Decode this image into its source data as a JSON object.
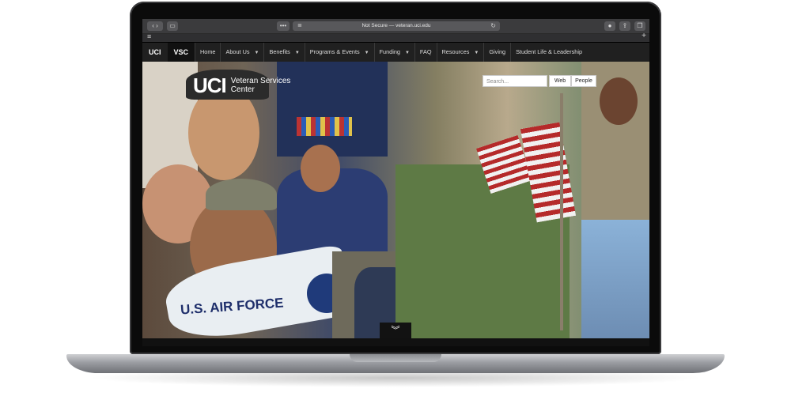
{
  "browser": {
    "url_text": "Not Secure — veteran.uci.edu",
    "dots": "•••",
    "menu": "≡",
    "plus": "+",
    "icons": [
      "back-icon",
      "forward-icon",
      "sidebar-icon",
      "reader-icon",
      "reload-icon",
      "info-icon",
      "share-icon",
      "tabs-icon"
    ]
  },
  "nav": {
    "brand": "UCI",
    "vsc": "VSC",
    "items": [
      {
        "label": "Home",
        "dropdown": false
      },
      {
        "label": "About Us",
        "dropdown": true
      },
      {
        "label": "Benefits",
        "dropdown": true
      },
      {
        "label": "Programs & Events",
        "dropdown": true
      },
      {
        "label": "Funding",
        "dropdown": true
      },
      {
        "label": "FAQ",
        "dropdown": false
      },
      {
        "label": "Resources",
        "dropdown": true
      },
      {
        "label": "Giving",
        "dropdown": false
      },
      {
        "label": "Student Life & Leadership",
        "dropdown": false
      }
    ]
  },
  "hero": {
    "logo_main": "UCI",
    "logo_sub_1": "Veteran Services",
    "logo_sub_2": "Center",
    "search_placeholder": "Search...",
    "btn_web": "Web",
    "btn_people": "People",
    "photo_text": "U.S. AIR FORCE",
    "scroll_down": "⌄"
  },
  "colors": {
    "nav_bg": "#202020",
    "chrome_bg": "#3b3b3d"
  }
}
